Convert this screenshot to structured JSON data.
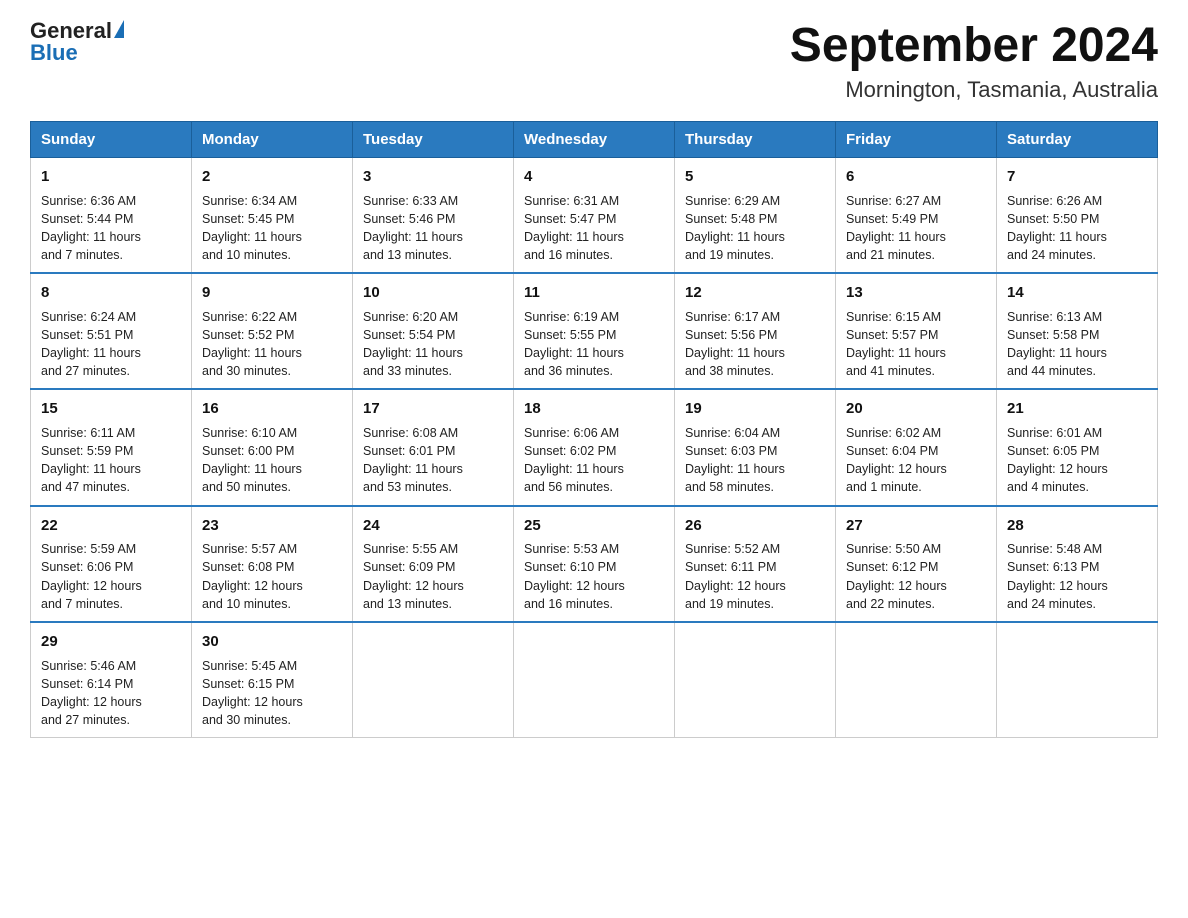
{
  "header": {
    "logo_general": "General",
    "logo_blue": "Blue",
    "title": "September 2024",
    "subtitle": "Mornington, Tasmania, Australia"
  },
  "days_of_week": [
    "Sunday",
    "Monday",
    "Tuesday",
    "Wednesday",
    "Thursday",
    "Friday",
    "Saturday"
  ],
  "weeks": [
    [
      {
        "day": "1",
        "sunrise": "6:36 AM",
        "sunset": "5:44 PM",
        "daylight": "11 hours and 7 minutes."
      },
      {
        "day": "2",
        "sunrise": "6:34 AM",
        "sunset": "5:45 PM",
        "daylight": "11 hours and 10 minutes."
      },
      {
        "day": "3",
        "sunrise": "6:33 AM",
        "sunset": "5:46 PM",
        "daylight": "11 hours and 13 minutes."
      },
      {
        "day": "4",
        "sunrise": "6:31 AM",
        "sunset": "5:47 PM",
        "daylight": "11 hours and 16 minutes."
      },
      {
        "day": "5",
        "sunrise": "6:29 AM",
        "sunset": "5:48 PM",
        "daylight": "11 hours and 19 minutes."
      },
      {
        "day": "6",
        "sunrise": "6:27 AM",
        "sunset": "5:49 PM",
        "daylight": "11 hours and 21 minutes."
      },
      {
        "day": "7",
        "sunrise": "6:26 AM",
        "sunset": "5:50 PM",
        "daylight": "11 hours and 24 minutes."
      }
    ],
    [
      {
        "day": "8",
        "sunrise": "6:24 AM",
        "sunset": "5:51 PM",
        "daylight": "11 hours and 27 minutes."
      },
      {
        "day": "9",
        "sunrise": "6:22 AM",
        "sunset": "5:52 PM",
        "daylight": "11 hours and 30 minutes."
      },
      {
        "day": "10",
        "sunrise": "6:20 AM",
        "sunset": "5:54 PM",
        "daylight": "11 hours and 33 minutes."
      },
      {
        "day": "11",
        "sunrise": "6:19 AM",
        "sunset": "5:55 PM",
        "daylight": "11 hours and 36 minutes."
      },
      {
        "day": "12",
        "sunrise": "6:17 AM",
        "sunset": "5:56 PM",
        "daylight": "11 hours and 38 minutes."
      },
      {
        "day": "13",
        "sunrise": "6:15 AM",
        "sunset": "5:57 PM",
        "daylight": "11 hours and 41 minutes."
      },
      {
        "day": "14",
        "sunrise": "6:13 AM",
        "sunset": "5:58 PM",
        "daylight": "11 hours and 44 minutes."
      }
    ],
    [
      {
        "day": "15",
        "sunrise": "6:11 AM",
        "sunset": "5:59 PM",
        "daylight": "11 hours and 47 minutes."
      },
      {
        "day": "16",
        "sunrise": "6:10 AM",
        "sunset": "6:00 PM",
        "daylight": "11 hours and 50 minutes."
      },
      {
        "day": "17",
        "sunrise": "6:08 AM",
        "sunset": "6:01 PM",
        "daylight": "11 hours and 53 minutes."
      },
      {
        "day": "18",
        "sunrise": "6:06 AM",
        "sunset": "6:02 PM",
        "daylight": "11 hours and 56 minutes."
      },
      {
        "day": "19",
        "sunrise": "6:04 AM",
        "sunset": "6:03 PM",
        "daylight": "11 hours and 58 minutes."
      },
      {
        "day": "20",
        "sunrise": "6:02 AM",
        "sunset": "6:04 PM",
        "daylight": "12 hours and 1 minute."
      },
      {
        "day": "21",
        "sunrise": "6:01 AM",
        "sunset": "6:05 PM",
        "daylight": "12 hours and 4 minutes."
      }
    ],
    [
      {
        "day": "22",
        "sunrise": "5:59 AM",
        "sunset": "6:06 PM",
        "daylight": "12 hours and 7 minutes."
      },
      {
        "day": "23",
        "sunrise": "5:57 AM",
        "sunset": "6:08 PM",
        "daylight": "12 hours and 10 minutes."
      },
      {
        "day": "24",
        "sunrise": "5:55 AM",
        "sunset": "6:09 PM",
        "daylight": "12 hours and 13 minutes."
      },
      {
        "day": "25",
        "sunrise": "5:53 AM",
        "sunset": "6:10 PM",
        "daylight": "12 hours and 16 minutes."
      },
      {
        "day": "26",
        "sunrise": "5:52 AM",
        "sunset": "6:11 PM",
        "daylight": "12 hours and 19 minutes."
      },
      {
        "day": "27",
        "sunrise": "5:50 AM",
        "sunset": "6:12 PM",
        "daylight": "12 hours and 22 minutes."
      },
      {
        "day": "28",
        "sunrise": "5:48 AM",
        "sunset": "6:13 PM",
        "daylight": "12 hours and 24 minutes."
      }
    ],
    [
      {
        "day": "29",
        "sunrise": "5:46 AM",
        "sunset": "6:14 PM",
        "daylight": "12 hours and 27 minutes."
      },
      {
        "day": "30",
        "sunrise": "5:45 AM",
        "sunset": "6:15 PM",
        "daylight": "12 hours and 30 minutes."
      },
      null,
      null,
      null,
      null,
      null
    ]
  ],
  "labels": {
    "sunrise": "Sunrise:",
    "sunset": "Sunset:",
    "daylight": "Daylight:"
  }
}
